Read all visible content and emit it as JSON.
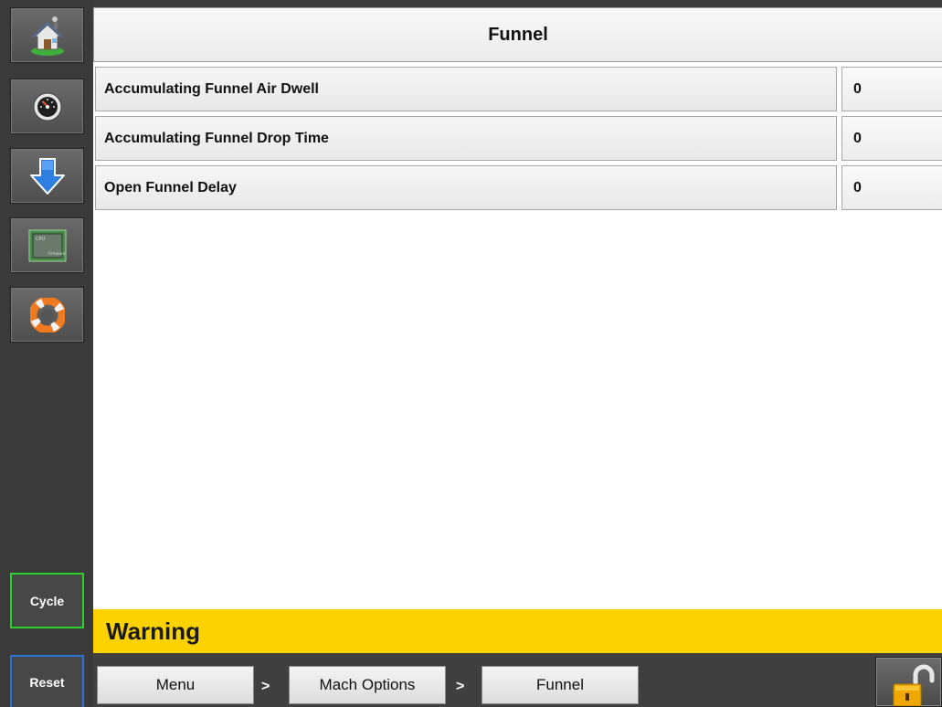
{
  "header": {
    "title": "Funnel"
  },
  "sidebar": {
    "items": [
      {
        "icon": "home-icon"
      },
      {
        "icon": "gauge-icon"
      },
      {
        "icon": "download-arrow-icon"
      },
      {
        "icon": "cpu-chip-icon"
      },
      {
        "icon": "lifebuoy-icon"
      }
    ],
    "cycle_label": "Cycle",
    "reset_label": "Reset"
  },
  "params": [
    {
      "label": "Accumulating Funnel Air Dwell",
      "value": "0"
    },
    {
      "label": "Accumulating Funnel Drop Time",
      "value": "0"
    },
    {
      "label": "Open Funnel Delay",
      "value": "0"
    }
  ],
  "warning": {
    "text": "Warning",
    "color": "#fcd200"
  },
  "breadcrumb": {
    "items": [
      "Menu",
      "Mach Options",
      "Funnel"
    ],
    "separator": ">"
  },
  "lock": {
    "icon": "unlocked-padlock-icon"
  },
  "colors": {
    "cycle_border": "#2bd12b",
    "reset_border": "#2a73d6"
  }
}
